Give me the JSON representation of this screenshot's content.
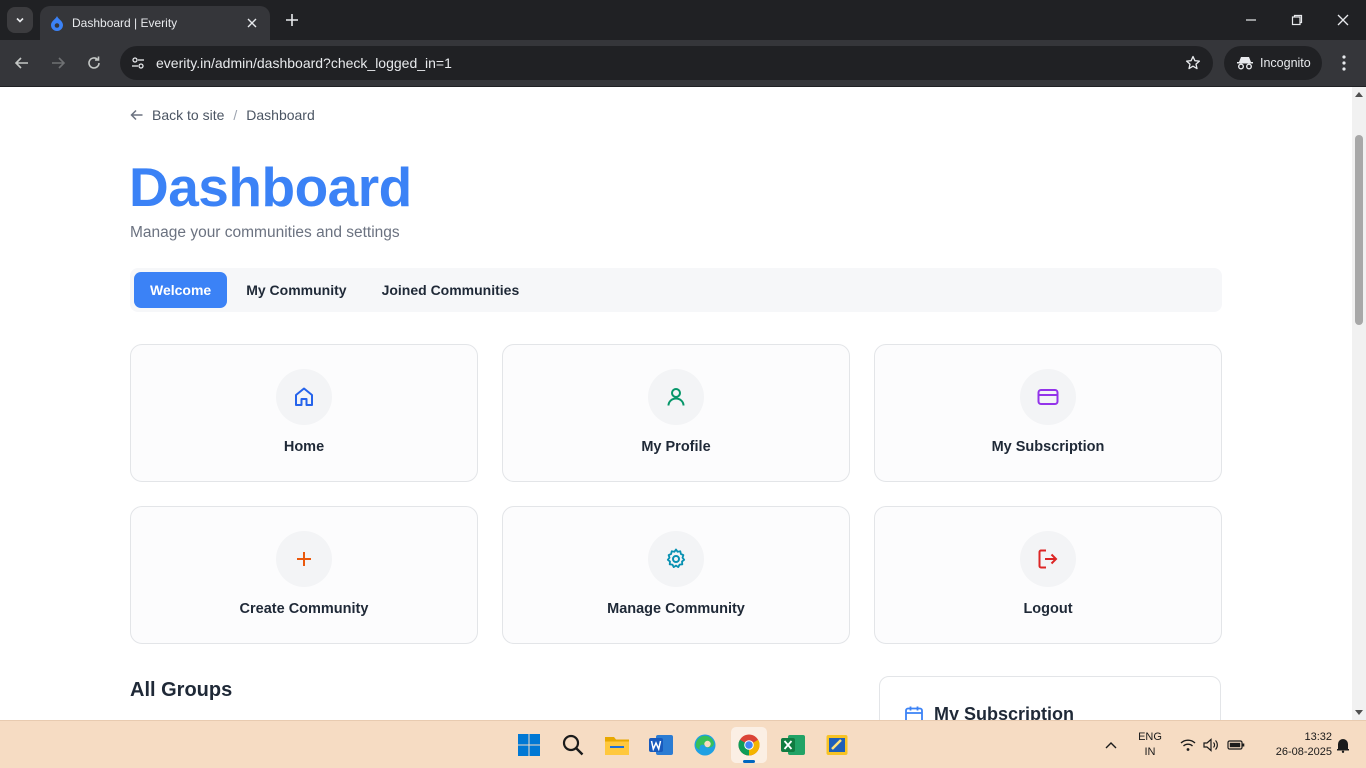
{
  "browser": {
    "tab_title": "Dashboard | Everity",
    "url": "everity.in/admin/dashboard?check_logged_in=1",
    "incognito_label": "Incognito"
  },
  "breadcrumb": {
    "back_label": "Back to site",
    "separator": "/",
    "current": "Dashboard"
  },
  "header": {
    "title": "Dashboard",
    "subtitle": "Manage your communities and settings"
  },
  "tabs": [
    {
      "label": "Welcome",
      "active": true
    },
    {
      "label": "My Community",
      "active": false
    },
    {
      "label": "Joined Communities",
      "active": false
    }
  ],
  "cards": [
    {
      "label": "Home",
      "icon": "home-icon",
      "color": "#2563eb"
    },
    {
      "label": "My Profile",
      "icon": "user-icon",
      "color": "#059669"
    },
    {
      "label": "My Subscription",
      "icon": "credit-card-icon",
      "color": "#9333ea"
    },
    {
      "label": "Create Community",
      "icon": "plus-icon",
      "color": "#ea580c"
    },
    {
      "label": "Manage Community",
      "icon": "gear-icon",
      "color": "#0891b2"
    },
    {
      "label": "Logout",
      "icon": "logout-icon",
      "color": "#dc2626"
    }
  ],
  "sections": {
    "all_groups_title": "All Groups",
    "subscription_title": "My Subscription"
  },
  "taskbar": {
    "language_line1": "ENG",
    "language_line2": "IN",
    "time": "13:32",
    "date": "26-08-2025"
  },
  "colors": {
    "accent": "#3b82f6",
    "taskbar_bg": "#f6dcc3",
    "chrome_dark": "#202124"
  }
}
